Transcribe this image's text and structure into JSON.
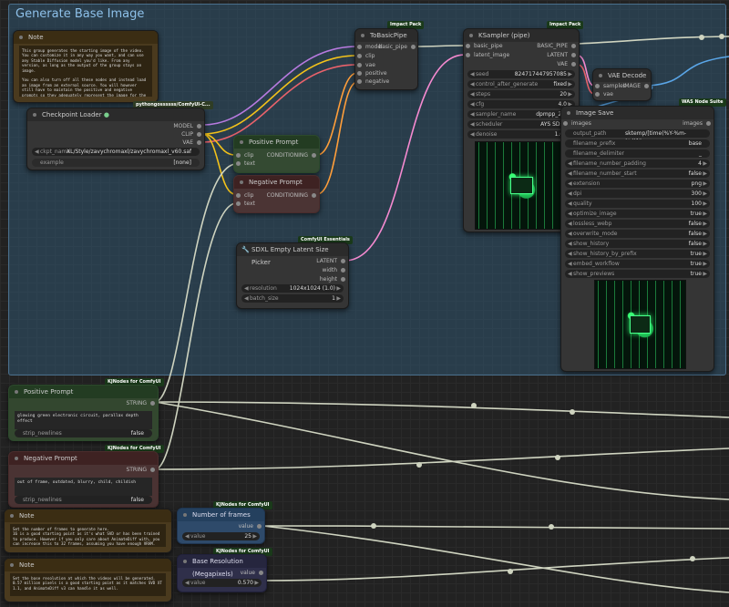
{
  "group": {
    "title": "Generate Base Image"
  },
  "note1": {
    "title": "Note",
    "body": "This group generates the starting image of the video. You can customize it in any way you want, and can use any Stable Diffusion model you'd like. From any version, as long as the output of the group stays an image.\n\nYou can also turn off all these nodes and instead load an image from an external source. You will however still have to maintain the positive and negative prompts so they adequately represent the image for the AnimateDiff workflow."
  },
  "checkpoint": {
    "badge": "pythongossssss/ComfyUI-C...",
    "title": "Checkpoint Loader",
    "outputs": [
      "MODEL",
      "CLIP",
      "VAE"
    ],
    "ckpt_label": "ckpt_name",
    "ckpt_value": "XL/Style/zavychromaxl/zavychromaxl_v60.safetensors",
    "example_label": "example",
    "example_value": "[none]"
  },
  "tobasic": {
    "badge": "Impact Pack",
    "title": "ToBasicPipe",
    "inputs": [
      "model",
      "clip",
      "vae",
      "positive",
      "negative"
    ],
    "output": "basic_pipe"
  },
  "pos_enc": {
    "title": "Positive Prompt",
    "inputs": [
      "clip",
      "text"
    ],
    "output": "CONDITIONING"
  },
  "neg_enc": {
    "title": "Negative Prompt",
    "inputs": [
      "clip",
      "text"
    ],
    "output": "CONDITIONING"
  },
  "ksampler": {
    "badge": "Impact Pack",
    "title": "KSampler (pipe)",
    "inputs": [
      "basic_pipe",
      "latent_image"
    ],
    "outputs": [
      "BASIC_PIPE",
      "LATENT",
      "VAE"
    ],
    "widgets": [
      {
        "label": "seed",
        "value": "824717447957085"
      },
      {
        "label": "control_after_generate",
        "value": "fixed"
      },
      {
        "label": "steps",
        "value": "20"
      },
      {
        "label": "cfg",
        "value": "4.0"
      },
      {
        "label": "sampler_name",
        "value": "dpmpp_2m"
      },
      {
        "label": "scheduler",
        "value": "AYS SDXL"
      },
      {
        "label": "denoise",
        "value": "1.00"
      }
    ]
  },
  "vae": {
    "title": "VAE Decode",
    "inputs": [
      "samples",
      "vae"
    ],
    "output": "IMAGE"
  },
  "imgsave": {
    "badge": "WAS Node Suite",
    "title": "Image Save",
    "input": "images",
    "output": "images",
    "widgets": [
      {
        "label": "output_path",
        "value": "sktemp/[time(%Y-%m-%d)]/img"
      },
      {
        "label": "filename_prefix",
        "value": "base"
      },
      {
        "label": "filename_delimiter",
        "value": "_"
      },
      {
        "label": "filename_number_padding",
        "value": "4"
      },
      {
        "label": "filename_number_start",
        "value": "false"
      },
      {
        "label": "extension",
        "value": "png"
      },
      {
        "label": "dpi",
        "value": "300"
      },
      {
        "label": "quality",
        "value": "100"
      },
      {
        "label": "optimize_image",
        "value": "true"
      },
      {
        "label": "lossless_webp",
        "value": "false"
      },
      {
        "label": "overwrite_mode",
        "value": "false"
      },
      {
        "label": "show_history",
        "value": "false"
      },
      {
        "label": "show_history_by_prefix",
        "value": "true"
      },
      {
        "label": "embed_workflow",
        "value": "true"
      },
      {
        "label": "show_previews",
        "value": "true"
      }
    ]
  },
  "latent": {
    "badge": "ComfyUI Essentials",
    "title": "SDXL Empty Latent Size Picker",
    "outputs": [
      "LATENT",
      "width",
      "height"
    ],
    "widgets": [
      {
        "label": "resolution",
        "value": "1024x1024 (1.0)"
      },
      {
        "label": "batch_size",
        "value": "1"
      }
    ]
  },
  "pos_prompt": {
    "badge": "KJNodes for ComfyUI",
    "title": "Positive Prompt",
    "output": "STRING",
    "text": "glowing green electronic circuit, parallax depth effect",
    "toggle_label": "strip_newlines",
    "toggle_value": "false"
  },
  "neg_prompt": {
    "badge": "KJNodes for ComfyUI",
    "title": "Negative Prompt",
    "output": "STRING",
    "text": "out of frame, outdated, blurry, child, childish",
    "toggle_label": "strip_newlines",
    "toggle_value": "false"
  },
  "note2": {
    "title": "Note",
    "body": "Set the number of frames to generate here.\n16 is a good starting point as it's what SVD or has been trained to produce. However if you only care about AnimateDiff with, you can increase this to 32 frames, assuming you have enough VRAM."
  },
  "frames": {
    "badge": "KJNodes for ComfyUI",
    "title": "Number of frames",
    "output": "value",
    "widget_label": "value",
    "widget_value": "25"
  },
  "note3": {
    "title": "Note",
    "body": "Set the base resolution at which the videos will be generated.\n0.57 million pixels is a good starting point as it matches SVD XT 1.1, and AnimateDiff v3 can handle it as well."
  },
  "baseres": {
    "badge": "KJNodes for ComfyUI",
    "title": "Base Resolution (Megapixels)",
    "output": "value",
    "widget_label": "value",
    "widget_value": "0.570"
  },
  "colors": {
    "purple_wire": "#b77adf",
    "yellow_wire": "#f2c21a",
    "pink_wire": "#f58ad0",
    "blue_wire": "#5aa6e8",
    "grey_wire": "#d7dccb",
    "red_wire": "#e9626b",
    "group_title": "#8ec1ea"
  }
}
